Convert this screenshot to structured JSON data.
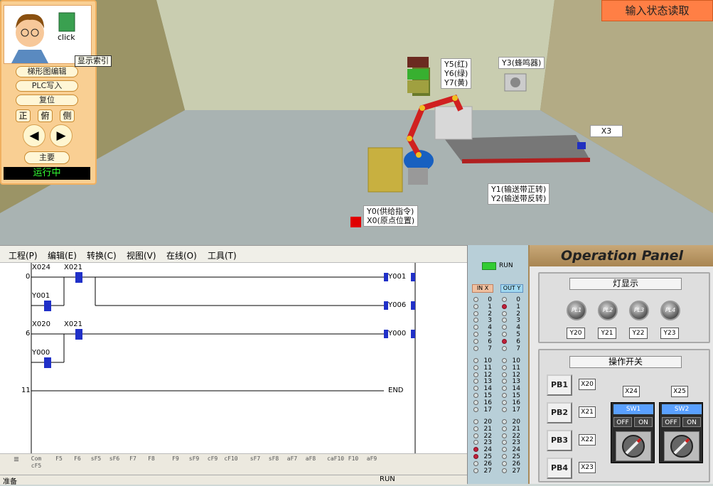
{
  "scene": {
    "status_read_button": "输入状态读取",
    "labels": {
      "tower_lights": [
        "Y5(红)",
        "Y6(绿)",
        "Y7(黄)"
      ],
      "buzzer": "Y3(蜂鸣器)",
      "sensor": "X3",
      "conveyor": [
        "Y1(输送带正转)",
        "Y2(输送带反转)"
      ],
      "supply": [
        "Y0(供给指令)",
        "X0(原点位置)"
      ]
    }
  },
  "nav": {
    "click_label": "click",
    "tooltip": "显示索引",
    "buttons": [
      "梯形图编辑",
      "PLC写入",
      "复位"
    ],
    "view_buttons": [
      "正",
      "俯",
      "侧"
    ],
    "left_arrow": "◀",
    "right_arrow": "▶",
    "main_button": "主要",
    "status": "运行中"
  },
  "editor": {
    "menus": [
      "工程(P)",
      "编辑(E)",
      "转换(C)",
      "视图(V)",
      "在线(O)",
      "工具(T)"
    ],
    "step_numbers": [
      "0",
      "6",
      "11"
    ],
    "contacts": [
      "X024",
      "X021",
      "Y001",
      "X020",
      "X021",
      "Y000"
    ],
    "coils": [
      "Y001",
      "Y006",
      "Y000"
    ],
    "end_label": "END",
    "toolbar": [
      "Com cF5",
      "F5",
      "F6",
      "sF5",
      "sF6",
      "F7",
      "F8",
      "F9",
      "sF9",
      "cF9",
      "cF10",
      "sF7",
      "sF8",
      "aF7",
      "aF8",
      "caF10",
      "F10",
      "aF9"
    ],
    "status_left": "准备",
    "status_run": "RUN"
  },
  "io": {
    "run_label": "RUN",
    "in_header": "IN X",
    "out_header": "OUT Y",
    "numbers_group1": [
      "0",
      "1",
      "2",
      "3",
      "4",
      "5",
      "6",
      "7"
    ],
    "numbers_group2": [
      "10",
      "11",
      "12",
      "13",
      "14",
      "15",
      "16",
      "17"
    ],
    "numbers_group3": [
      "20",
      "21",
      "22",
      "23",
      "24",
      "25",
      "26",
      "27"
    ],
    "in_on": [
      "24",
      "25"
    ],
    "out_on": [
      "1",
      "6"
    ]
  },
  "oppanel": {
    "title": "Operation Panel",
    "lights_group": "灯显示",
    "lights": [
      {
        "name": "PL1",
        "addr": "Y20"
      },
      {
        "name": "PL2",
        "addr": "Y21"
      },
      {
        "name": "PL3",
        "addr": "Y22"
      },
      {
        "name": "PL4",
        "addr": "Y23"
      }
    ],
    "switch_group": "操作开关",
    "pushbuttons": [
      {
        "name": "PB1",
        "addr": "X20"
      },
      {
        "name": "PB2",
        "addr": "X21"
      },
      {
        "name": "PB3",
        "addr": "X22"
      },
      {
        "name": "PB4",
        "addr": "X23"
      }
    ],
    "switches": [
      {
        "name": "SW1",
        "addr": "X24",
        "off": "OFF",
        "on": "ON"
      },
      {
        "name": "SW2",
        "addr": "X25",
        "off": "OFF",
        "on": "ON"
      }
    ]
  }
}
